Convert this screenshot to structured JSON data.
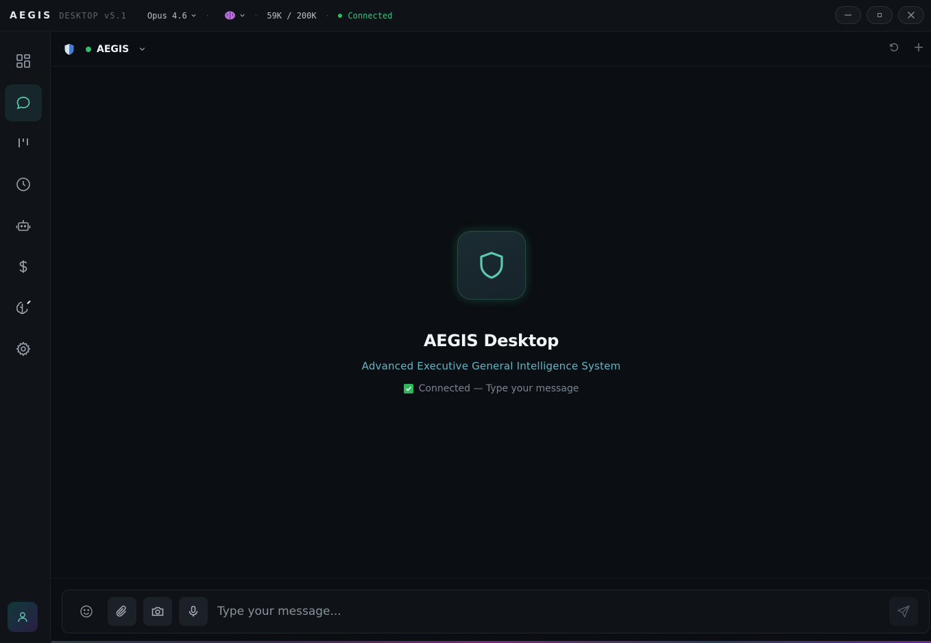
{
  "titlebar": {
    "brand": "AEGIS",
    "brand_sub": "DESKTOP v5.1",
    "model": "Opus 4.6",
    "tokens": "59K / 200K",
    "status": "Connected",
    "separator": "·"
  },
  "sidebar": {
    "items": [
      {
        "icon": "dashboard-grid-icon",
        "active": false
      },
      {
        "icon": "chat-bubble-icon",
        "active": true
      },
      {
        "icon": "kanban-columns-icon",
        "active": false
      },
      {
        "icon": "clock-icon",
        "active": false
      },
      {
        "icon": "robot-icon",
        "active": false
      },
      {
        "icon": "dollar-icon",
        "active": false
      },
      {
        "icon": "brain-edit-icon",
        "active": false
      },
      {
        "icon": "gear-icon",
        "active": false
      }
    ],
    "user_icon": "user-icon"
  },
  "agent_bar": {
    "name": "AEGIS",
    "status_color": "#2fbf6a"
  },
  "welcome": {
    "title": "AEGIS Desktop",
    "subtitle": "Advanced Executive General Intelligence System",
    "status": "Connected — Type your message"
  },
  "composer": {
    "placeholder": "Type your message..."
  },
  "colors": {
    "accent": "#5cc9b0",
    "connected": "#3fbf83",
    "background": "#0b0e12"
  }
}
